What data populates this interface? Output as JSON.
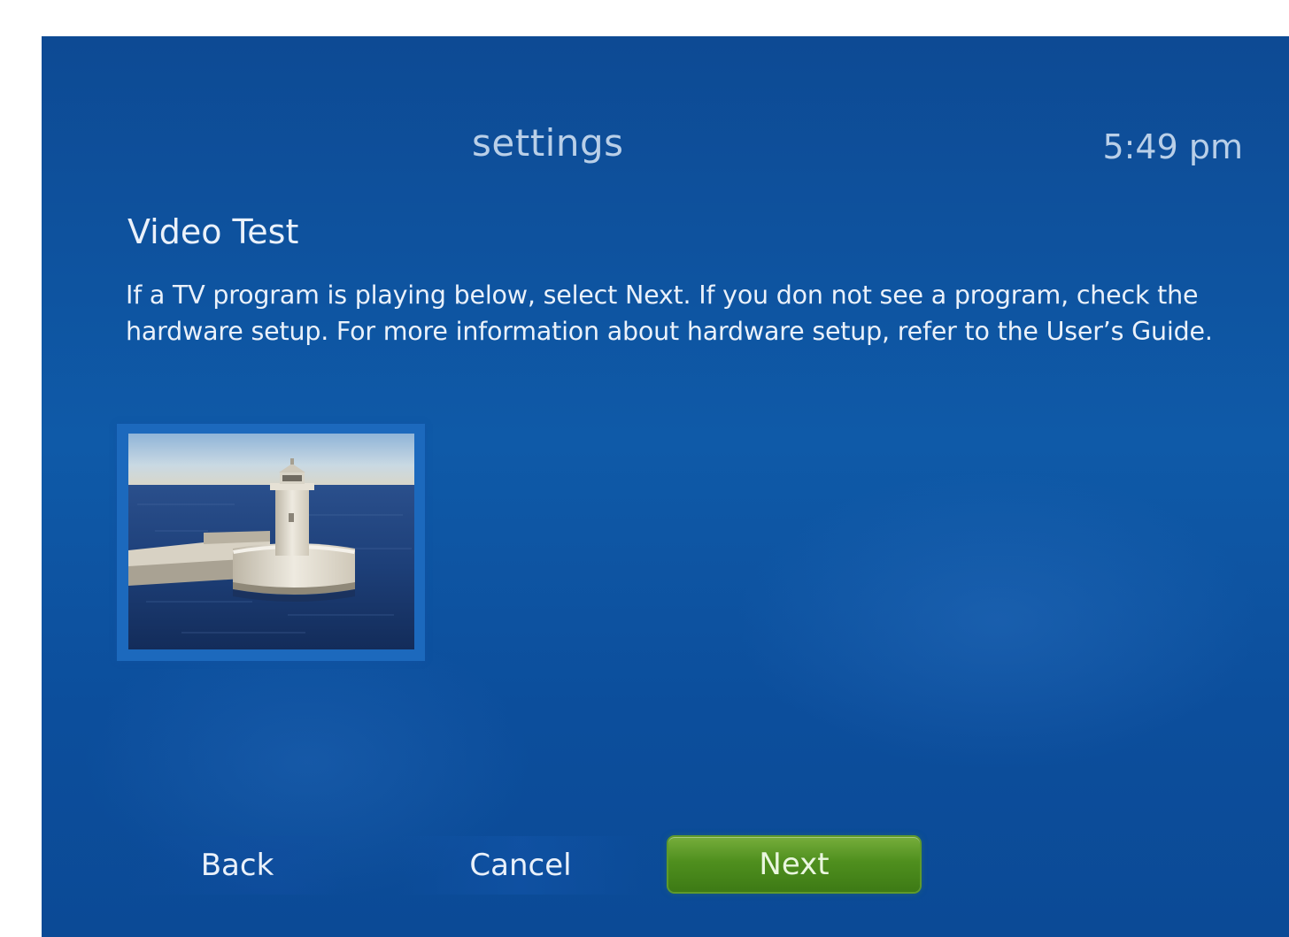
{
  "header": {
    "title": "settings",
    "time": "5:49 pm"
  },
  "page": {
    "heading": "Video Test",
    "description": "If a TV program is playing below, select Next. If you don not see a program, check the hardware setup. For more information about hardware setup, refer to the User’s Guide."
  },
  "video_preview": {
    "icon": "lighthouse-video-preview"
  },
  "buttons": {
    "back_label": "Back",
    "cancel_label": "Cancel",
    "next_label": "Next"
  },
  "colors": {
    "background": "#0f5aa8",
    "accent_green": "#4f8f1e",
    "text": "#eaf1fa"
  }
}
